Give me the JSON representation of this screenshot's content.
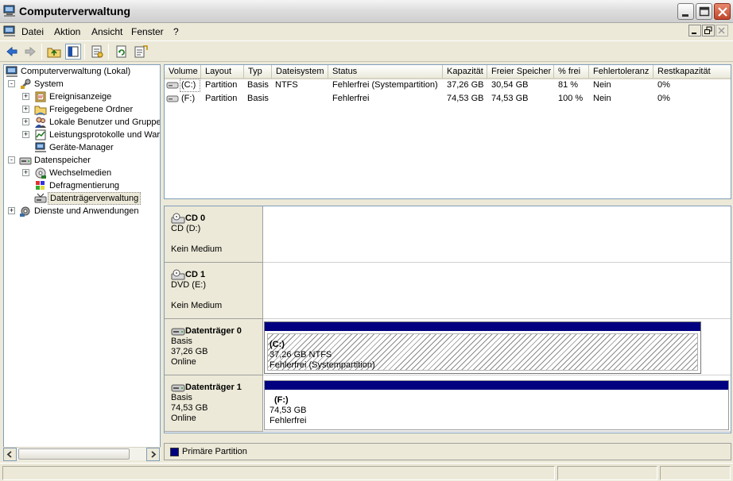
{
  "window": {
    "title": "Computerverwaltung"
  },
  "menu": {
    "items": [
      "Datei",
      "Aktion",
      "Ansicht",
      "Fenster",
      "?"
    ]
  },
  "tree": {
    "items": [
      {
        "label": "Computerverwaltung (Lokal)",
        "icon": "computer-icon",
        "expander": ""
      },
      {
        "label": "System",
        "icon": "tools-icon",
        "expander": "-"
      },
      {
        "label": "Ereignisanzeige",
        "icon": "event-viewer-icon",
        "expander": "+"
      },
      {
        "label": "Freigegebene Ordner",
        "icon": "shared-folder-icon",
        "expander": "+"
      },
      {
        "label": "Lokale Benutzer und Gruppen",
        "icon": "users-icon",
        "expander": "+"
      },
      {
        "label": "Leistungsprotokolle und Warnungen",
        "icon": "performance-icon",
        "expander": "+"
      },
      {
        "label": "Geräte-Manager",
        "icon": "device-manager-icon",
        "expander": ""
      },
      {
        "label": "Datenspeicher",
        "icon": "storage-icon",
        "expander": "-"
      },
      {
        "label": "Wechselmedien",
        "icon": "removable-media-icon",
        "expander": "+"
      },
      {
        "label": "Defragmentierung",
        "icon": "defrag-icon",
        "expander": ""
      },
      {
        "label": "Datenträgerverwaltung",
        "icon": "disk-management-icon",
        "expander": "",
        "selected": true
      },
      {
        "label": "Dienste und Anwendungen",
        "icon": "services-icon",
        "expander": "+"
      }
    ]
  },
  "volumes": {
    "columns": [
      "Volume",
      "Layout",
      "Typ",
      "Dateisystem",
      "Status",
      "Kapazität",
      "Freier Speicher",
      "% frei",
      "Fehlertoleranz",
      "Restkapazität"
    ],
    "rows": [
      [
        "(C:)",
        "Partition",
        "Basis",
        "NTFS",
        "Fehlerfrei (Systempartition)",
        "37,26 GB",
        "30,54 GB",
        "81 %",
        "Nein",
        "0%"
      ],
      [
        "(F:)",
        "Partition",
        "Basis",
        "",
        "Fehlerfrei",
        "74,53 GB",
        "74,53 GB",
        "100 %",
        "Nein",
        "0%"
      ]
    ]
  },
  "disks": [
    {
      "name": "CD 0",
      "lines": [
        "CD (D:)",
        "",
        "Kein Medium"
      ],
      "icon": "cd-drive-icon"
    },
    {
      "name": "CD 1",
      "lines": [
        "DVD (E:)",
        "",
        "Kein Medium"
      ],
      "icon": "cd-drive-icon"
    },
    {
      "name": "Datenträger 0",
      "lines": [
        "Basis",
        "37,26 GB",
        "Online"
      ],
      "icon": "hard-disk-icon",
      "partition": {
        "title": "(C:)",
        "size": "37,26 GB NTFS",
        "status": "Fehlerfrei (Systempartition)"
      }
    },
    {
      "name": "Datenträger 1",
      "lines": [
        "Basis",
        "74,53 GB",
        "Online"
      ],
      "icon": "hard-disk-icon",
      "partition": {
        "title": "(F:)",
        "size": "74,53 GB",
        "status": "Fehlerfrei"
      }
    }
  ],
  "legend": {
    "label": "Primäre Partition",
    "color": "#000080"
  },
  "colors": {
    "partition_bar": "#000080",
    "window_bg": "#ece9d8"
  }
}
